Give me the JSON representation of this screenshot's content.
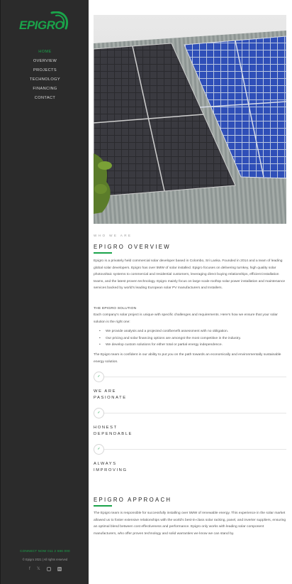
{
  "brand": {
    "logo_text": "EPIGRO",
    "accent": "#1aa34a"
  },
  "nav": {
    "items": [
      {
        "label": "HOME",
        "active": true
      },
      {
        "label": "OVERVIEW",
        "active": false
      },
      {
        "label": "PROJECTS",
        "active": false
      },
      {
        "label": "TECHNOLOGY",
        "active": false
      },
      {
        "label": "FINANCING",
        "active": false
      },
      {
        "label": "CONTACT",
        "active": false
      }
    ]
  },
  "footer": {
    "connect": "CONNECT NOW 011 2 686 000",
    "copyright": "© Epigro 2021 | All rights reserved",
    "socials": [
      "facebook-icon",
      "twitter-icon",
      "instagram-icon",
      "linkedin-icon"
    ]
  },
  "overview": {
    "eyebrow": "WHO WE ARE",
    "title": "EPIGRO OVERVIEW",
    "intro": "Epigro is a privately held commercial solar developer based in Colombo, Sri Lanka. Founded in 2014 and a team of leading global solar developers. Epigro has over 5MW of solar installed. Epigro focuses on delivering turnkey, high quality solar photovoltaic systems to commercial and residential customers, leveraging direct buying relationships, efficient installation teams, and the latest proven technology. Epigro mainly focus on large scale rooftop solar power installation and maintenance services backed by world's leading European solar PV manufacturers and Installers.",
    "solution_heading": "THE EPIGRO SOLUTION",
    "solution_text": "Each company's solar project is unique with specific challenges and requirements. Here's how we ensure that your solar solution is the right one:",
    "bullets": [
      "We provide analysis and a projected cost/benefit assessment with no obligation.",
      "Our pricing and solar financing options are amongst the most competitive in the industry.",
      "We develop custom solutions for either total or partial energy independence."
    ],
    "closing": "The Epigro team is confident in our ability to put you on the path towards an economically and environmentally sustainable energy solution."
  },
  "values": [
    {
      "line1": "WE ARE",
      "line2": "PASIONATE"
    },
    {
      "line1": "HONEST",
      "line2": "DEPENDABLE"
    },
    {
      "line1": "ALWAYS",
      "line2": "IMPROVING"
    }
  ],
  "approach": {
    "title": "EPIGRO APPROACH",
    "text": "The Epigro team is responsible for successfully installing over 5MW of renewable energy. This experience in the solar market allowed us to foster extensive relationships with the world's best-in-class solar racking, panel, and inverter suppliers, ensuring an optimal blend between cost effectiveness and performance. Epigro only works with leading solar component manufacturers, who offer proven technology and solid warranties we know we can stand by."
  }
}
